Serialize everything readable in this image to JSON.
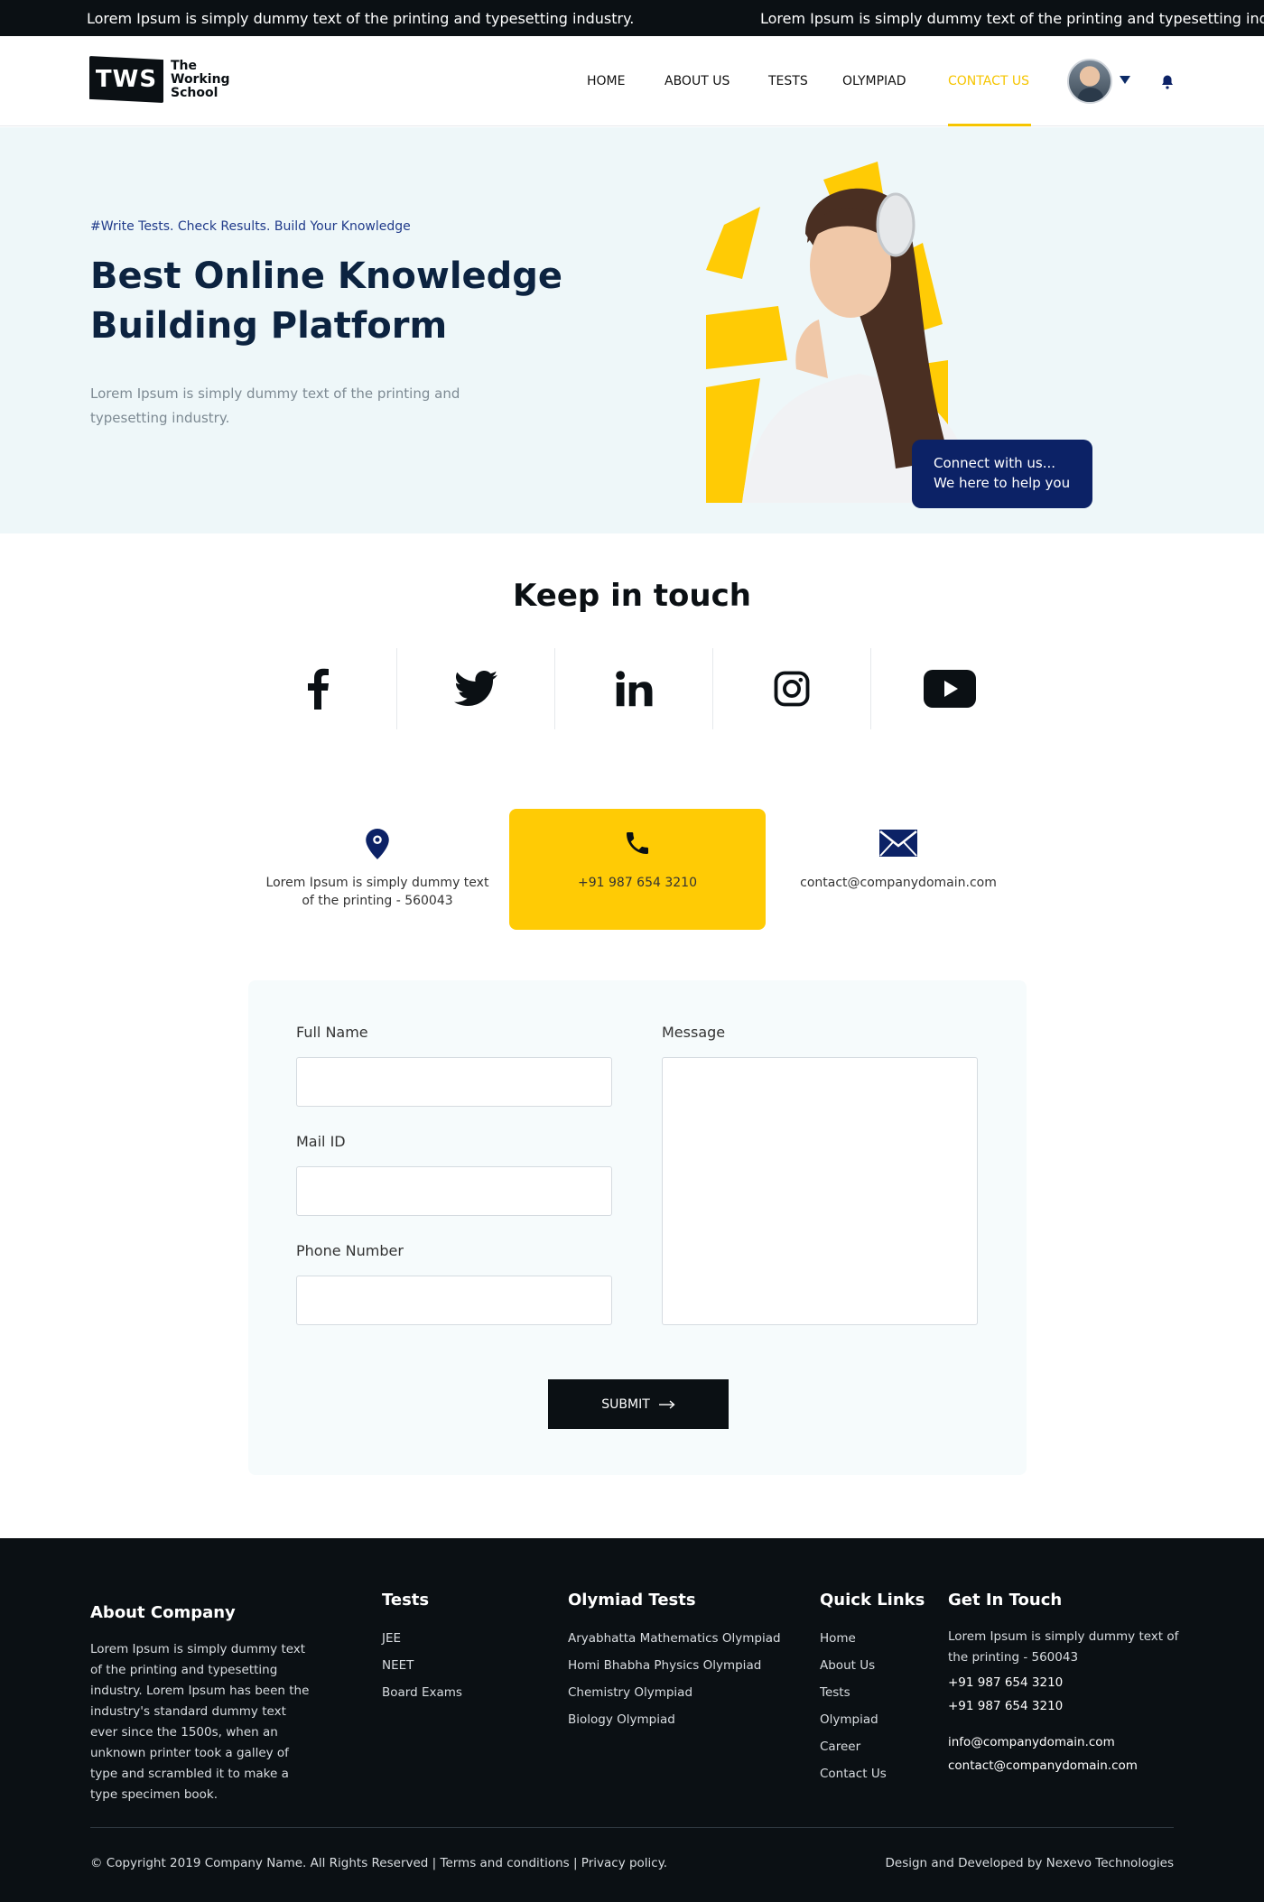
{
  "ticker": {
    "text_1": "Lorem Ipsum is simply dummy text of the printing and typesetting industry.",
    "text_2": "Lorem Ipsum is simply dummy text of the printing and typesetting industry."
  },
  "header": {
    "logo_badge": "TWS",
    "logo_line1": "The",
    "logo_line2": "Working",
    "logo_line3": "School",
    "nav": [
      "HOME",
      "ABOUT US",
      "TESTS",
      "OLYMPIAD",
      "CONTACT US"
    ],
    "active_nav": "CONTACT US",
    "accent_color": "#f6c500"
  },
  "hero": {
    "tag": "#Write Tests. Check Results. Build Your Knowledge",
    "title_line1": "Best Online Knowledge",
    "title_line2": "Building Platform",
    "description": "Lorem Ipsum is simply dummy text of the printing and typesetting industry.",
    "connect_line1": "Connect with us...",
    "connect_line2": "We here to help you",
    "background": "#eef7f9"
  },
  "keep_in_touch": {
    "title": "Keep in touch",
    "socials": [
      "facebook-icon",
      "twitter-icon",
      "linkedin-icon",
      "instagram-icon",
      "youtube-icon"
    ]
  },
  "contact_info": {
    "address": "Lorem Ipsum is simply dummy text of the printing - 560043",
    "phone": "+91 987 654 3210",
    "email": "contact@companydomain.com",
    "card_color": "#ffcb05"
  },
  "form": {
    "full_name_label": "Full Name",
    "full_name_value": "",
    "mail_label": "Mail ID",
    "mail_value": "",
    "phone_label": "Phone Number",
    "phone_value": "",
    "message_label": "Message",
    "message_value": "",
    "submit_label": "SUBMIT"
  },
  "footer": {
    "about_title": "About Company",
    "about_text": "Lorem Ipsum is simply dummy text of the printing and typesetting industry. Lorem Ipsum has been the industry's standard dummy text ever since the 1500s, when an unknown printer took a galley of type and scrambled it to make a type specimen book.",
    "tests_title": "Tests",
    "tests": [
      "JEE",
      "NEET",
      "Board Exams"
    ],
    "olympiad_title": "Olymiad Tests",
    "olympiads": [
      "Aryabhatta Mathematics Olympiad",
      "Homi Bhabha Physics Olympiad",
      "Chemistry Olympiad",
      "Biology Olympiad"
    ],
    "quick_title": "Quick Links",
    "quick_links": [
      "Home",
      "About Us",
      "Tests",
      "Olympiad",
      "Career",
      "Contact Us"
    ],
    "touch_title": "Get In Touch",
    "touch_address": "Lorem Ipsum is simply dummy text of the printing - 560043",
    "touch_phone_1": "+91 987 654 3210",
    "touch_phone_2": "+91 987 654 3210",
    "touch_email_1": "info@companydomain.com",
    "touch_email_2": "contact@companydomain.com",
    "copyright": "© Copyright 2019 Company Name. All Rights Reserved | Terms and conditions | Privacy policy.",
    "credit": "Design and Developed by Nexevo Technologies"
  }
}
